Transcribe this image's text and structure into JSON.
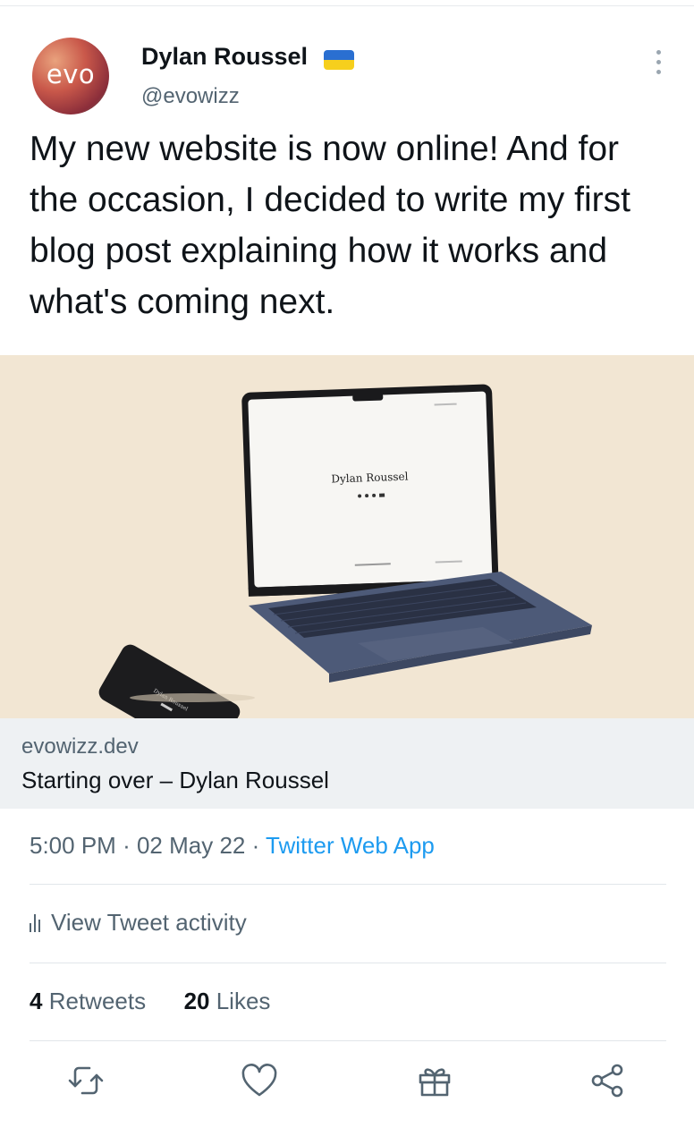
{
  "author": {
    "name": "Dylan Roussel",
    "handle": "@evowizz",
    "avatar_text": "evo",
    "flag": "ukraine-flag"
  },
  "tweet": {
    "text": "My new website is now online! And for the occasion, I decided to write my first blog post explaining how it works and what's coming next."
  },
  "card": {
    "domain": "evowizz.dev",
    "title": "Starting over – Dylan Roussel",
    "image": {
      "screen_title": "Dylan Roussel",
      "phone_title": "Dylan Roussel",
      "background_color": "#f2e6d3",
      "laptop_color": "#4d5a78"
    }
  },
  "meta": {
    "time": "5:00 PM",
    "date": "02 May 22",
    "separator": "·",
    "source": "Twitter Web App"
  },
  "activity_label": "View Tweet activity",
  "stats": {
    "retweets_count": "4",
    "retweets_label": "Retweets",
    "likes_count": "20",
    "likes_label": "Likes"
  },
  "actions": [
    "retweet-icon",
    "like-icon",
    "gift-icon",
    "share-icon"
  ],
  "colors": {
    "accent": "#1d9bf0",
    "secondary_text": "#536471",
    "primary_text": "#0f1419"
  }
}
